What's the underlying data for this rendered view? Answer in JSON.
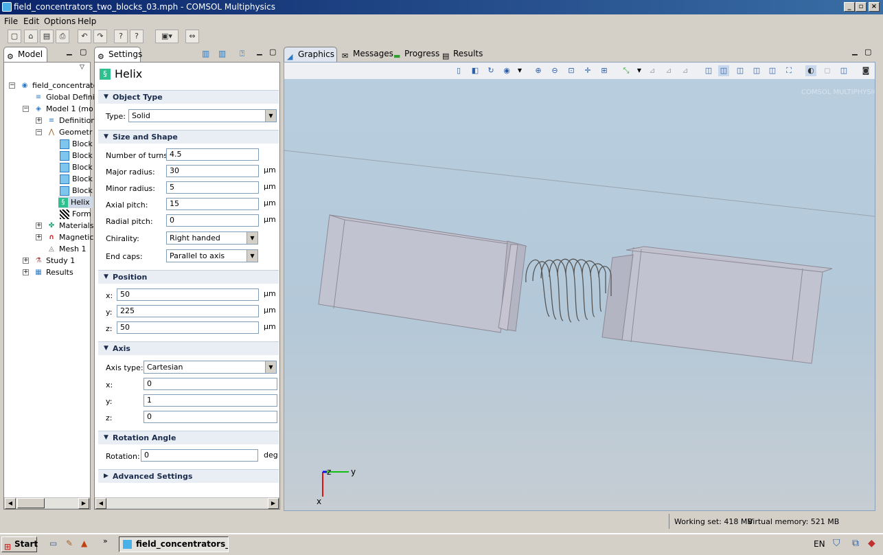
{
  "window": {
    "title": "field_concentrators_two_blocks_03.mph - COMSOL Multiphysics"
  },
  "menu": [
    "File",
    "Edit",
    "Options",
    "Help"
  ],
  "model_tab": {
    "label": "Model"
  },
  "tree": [
    {
      "label": "field_concentrato",
      "icon": "root-icon"
    },
    {
      "label": "Global Definit",
      "icon": "global-definitions-icon"
    },
    {
      "label": "Model 1 (mo",
      "icon": "model-icon"
    },
    {
      "label": "Definition",
      "icon": "definitions-icon"
    },
    {
      "label": "Geometr",
      "icon": "geometry-icon"
    },
    {
      "label": "Block",
      "icon": "block-icon"
    },
    {
      "label": "Block",
      "icon": "block-icon"
    },
    {
      "label": "Block",
      "icon": "block-icon"
    },
    {
      "label": "Block",
      "icon": "block-icon"
    },
    {
      "label": "Block",
      "icon": "block-icon"
    },
    {
      "label": "Helix",
      "icon": "helix-icon"
    },
    {
      "label": "Form",
      "icon": "form-union-icon"
    },
    {
      "label": "Materials",
      "icon": "materials-icon"
    },
    {
      "label": "Magnetic",
      "icon": "magnetic-icon"
    },
    {
      "label": "Mesh 1",
      "icon": "mesh-icon"
    },
    {
      "label": "Study 1",
      "icon": "study-icon"
    },
    {
      "label": "Results",
      "icon": "results-icon"
    }
  ],
  "settings": {
    "tab_label": "Settings",
    "heading": "Helix",
    "object_type": {
      "section": "Object Type",
      "type_label": "Type:",
      "type_value": "Solid"
    },
    "size_shape": {
      "section": "Size and Shape",
      "turns_label": "Number of turns:",
      "turns": "4.5",
      "major_label": "Major radius:",
      "major": "30",
      "minor_label": "Minor radius:",
      "minor": "5",
      "axial_label": "Axial pitch:",
      "axial": "15",
      "radial_label": "Radial pitch:",
      "radial": "0",
      "chirality_label": "Chirality:",
      "chirality": "Right handed",
      "endcaps_label": "End caps:",
      "endcaps": "Parallel to axis",
      "unit": "µm"
    },
    "position": {
      "section": "Position",
      "x_label": "x:",
      "x": "50",
      "y_label": "y:",
      "y": "225",
      "z_label": "z:",
      "z": "50",
      "unit": "µm"
    },
    "axis": {
      "section": "Axis",
      "type_label": "Axis type:",
      "type": "Cartesian",
      "x_label": "x:",
      "x": "0",
      "y_label": "y:",
      "y": "1",
      "z_label": "z:",
      "z": "0"
    },
    "rotation": {
      "section": "Rotation Angle",
      "label": "Rotation:",
      "value": "0",
      "unit": "deg"
    },
    "advanced": {
      "section": "Advanced Settings"
    }
  },
  "graphics_tabs": [
    {
      "label": "Graphics",
      "icon": "graphics-icon"
    },
    {
      "label": "Messages",
      "icon": "messages-icon"
    },
    {
      "label": "Progress",
      "icon": "progress-icon"
    },
    {
      "label": "Results",
      "icon": "results-icon"
    }
  ],
  "graphics": {
    "watermark": "COMSOL MULTIPHYSICS",
    "axis_x": "x",
    "axis_y": "y",
    "axis_z": "z"
  },
  "status": {
    "working_set": "Working set: 418 MB",
    "virtual_memory": "Virtual memory: 521 MB"
  },
  "taskbar": {
    "start": "Start",
    "task": "field_concentrators_t...",
    "lang": "EN"
  }
}
